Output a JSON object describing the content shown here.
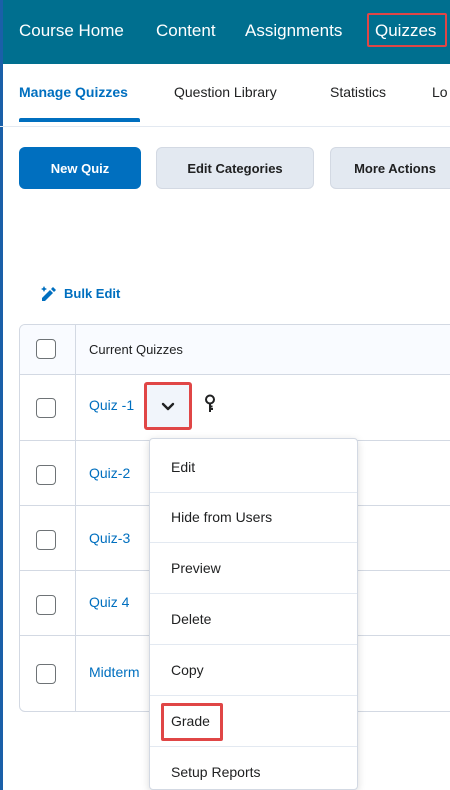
{
  "navbar": {
    "items": [
      "Course Home",
      "Content",
      "Assignments",
      "Quizzes"
    ]
  },
  "tabs": {
    "items": [
      "Manage Quizzes",
      "Question Library",
      "Statistics",
      "Lo"
    ]
  },
  "buttons": {
    "new_quiz": "New Quiz",
    "edit_categories": "Edit Categories",
    "more_actions": "More Actions"
  },
  "bulk_edit": {
    "label": "Bulk Edit"
  },
  "table": {
    "header": "Current Quizzes",
    "rows": [
      "Quiz -1",
      "Quiz-2",
      "Quiz-3",
      "Quiz 4",
      "Midterm"
    ]
  },
  "menu": {
    "items": [
      "Edit",
      "Hide from Users",
      "Preview",
      "Delete",
      "Copy",
      "Grade",
      "Setup Reports"
    ]
  },
  "colors": {
    "navbar": "#006f8f",
    "link": "#006fbf",
    "highlight": "#e04646"
  }
}
